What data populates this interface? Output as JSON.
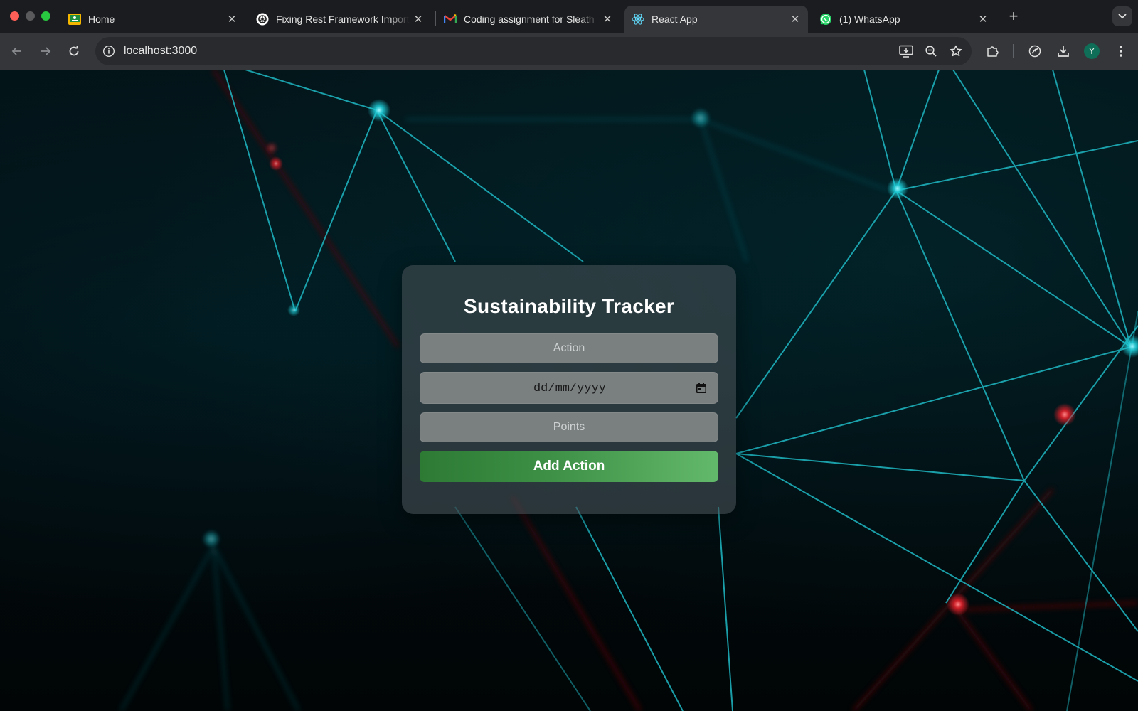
{
  "browser": {
    "tabs": [
      {
        "title": "Home",
        "icon": "classroom-icon",
        "active": false
      },
      {
        "title": "Fixing Rest Framework Import",
        "icon": "chatgpt-icon",
        "active": false
      },
      {
        "title": "Coding assignment for Sleath",
        "icon": "gmail-icon",
        "active": false
      },
      {
        "title": "React App",
        "icon": "react-icon",
        "active": true
      },
      {
        "title": "(1) WhatsApp",
        "icon": "whatsapp-icon",
        "active": false
      }
    ],
    "tab_close_glyph": "✕",
    "new_tab_glyph": "+",
    "address": "localhost:3000",
    "profile_initial": "Y"
  },
  "form": {
    "title": "Sustainability Tracker",
    "action_placeholder": "Action",
    "date_placeholder": "dd/mm/yyyy",
    "points_placeholder": "Points",
    "submit_label": "Add Action"
  },
  "colors": {
    "accent_green": "#3e9147",
    "network_cyan": "#1ecbd6",
    "network_red": "#e0202a",
    "background": "#02090c"
  }
}
